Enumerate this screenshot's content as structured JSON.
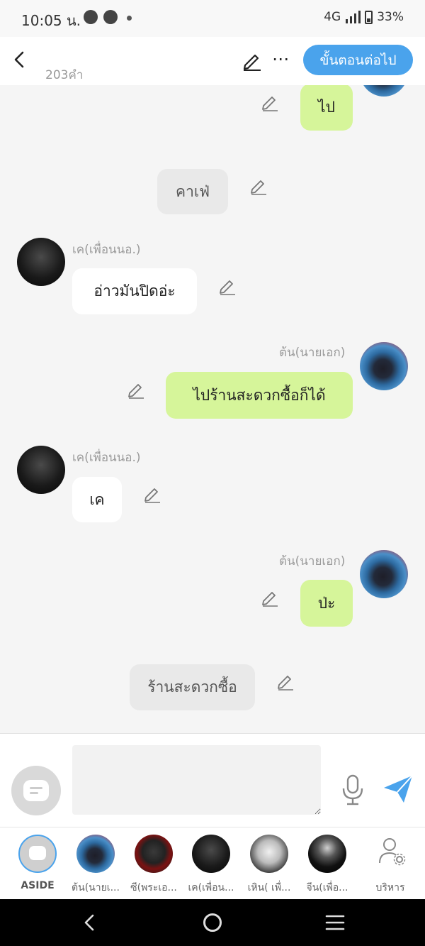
{
  "status_bar": {
    "time": "10:05 น.",
    "network": "4G",
    "battery": "33%"
  },
  "header": {
    "word_count": "203คำ",
    "next_button": "ขั้นตอนต่อไป"
  },
  "messages": [
    {
      "type": "me",
      "text": "ไป"
    },
    {
      "type": "narration",
      "text": "คาเฟ่"
    },
    {
      "type": "friend",
      "name": "เค(เพื่อนนอ.)",
      "text": "อ่าวมันปิดอ่ะ"
    },
    {
      "type": "me",
      "name": "ต้น(นายเอก)",
      "text": "ไปร้านสะดวกซื้อก็ได้"
    },
    {
      "type": "friend",
      "name": "เค(เพื่อนนอ.)",
      "text": "เค"
    },
    {
      "type": "me",
      "name": "ต้น(นายเอก)",
      "text": "ป่ะ"
    },
    {
      "type": "narration",
      "text": "ร้านสะดวกซื้อ"
    }
  ],
  "composer": {
    "placeholder": ""
  },
  "characters": [
    {
      "label": "ASIDE"
    },
    {
      "label": "ต้น(นายเ..."
    },
    {
      "label": "ซี(พระเอ..."
    },
    {
      "label": "เค(เพื่อน..."
    },
    {
      "label": "เหิน( เพื่..."
    },
    {
      "label": "จีน(เพื่อ..."
    },
    {
      "label": "บริหาร"
    }
  ],
  "colors": {
    "accent": "#4aa3ec",
    "my_bubble": "#d6f59a",
    "friend_bubble": "#ffffff",
    "narration_bubble": "#e9e9e9"
  },
  "icons": [
    "back-icon",
    "edit-icon",
    "more-icon",
    "pencil-icon",
    "mic-icon",
    "send-icon",
    "admin-icon"
  ]
}
